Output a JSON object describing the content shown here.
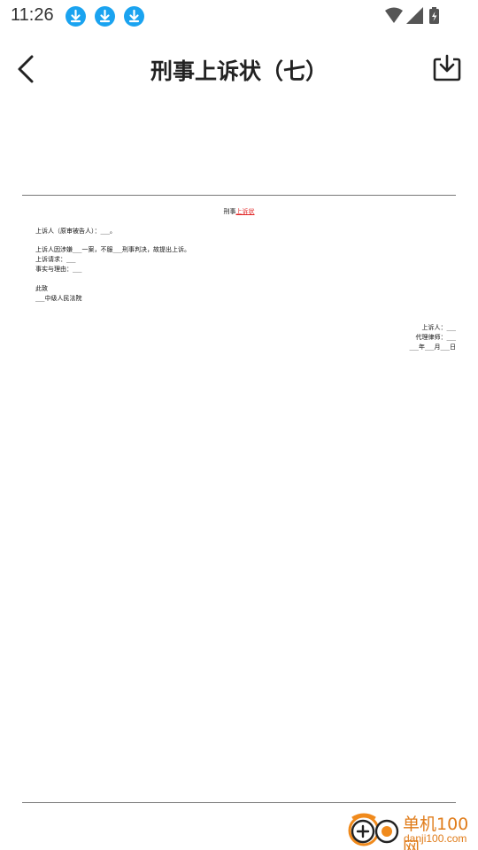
{
  "status_bar": {
    "time": "11:26",
    "notification_icons": [
      "download-icon",
      "download-icon",
      "download-icon"
    ],
    "system_icons": [
      "wifi-icon",
      "signal-icon",
      "battery-charging-icon"
    ]
  },
  "app_bar": {
    "title": "刑事上诉状（七）",
    "back_icon": "chevron-left-icon",
    "download_icon": "download-tray-icon"
  },
  "document": {
    "title_prefix": "刑事",
    "title_link": "上诉状",
    "line1": "上诉人（原审被告人）：___。",
    "line2": "上诉人因涉嫌___一案，不服___刑事判决，故提出上诉。",
    "line3": "上诉请求：___",
    "line4": "事实与理由：___",
    "line5": "此致",
    "line6": "___中级人民法院",
    "sign1": "上诉人：___",
    "sign2": "代理律师：___",
    "sign3": "___年___月___日"
  },
  "watermark": {
    "text": "单机100网",
    "url": "danji100.com"
  },
  "colors": {
    "status_accent": "#1aa3f0",
    "link_red": "#e02020",
    "watermark_orange": "#e07c1a"
  }
}
